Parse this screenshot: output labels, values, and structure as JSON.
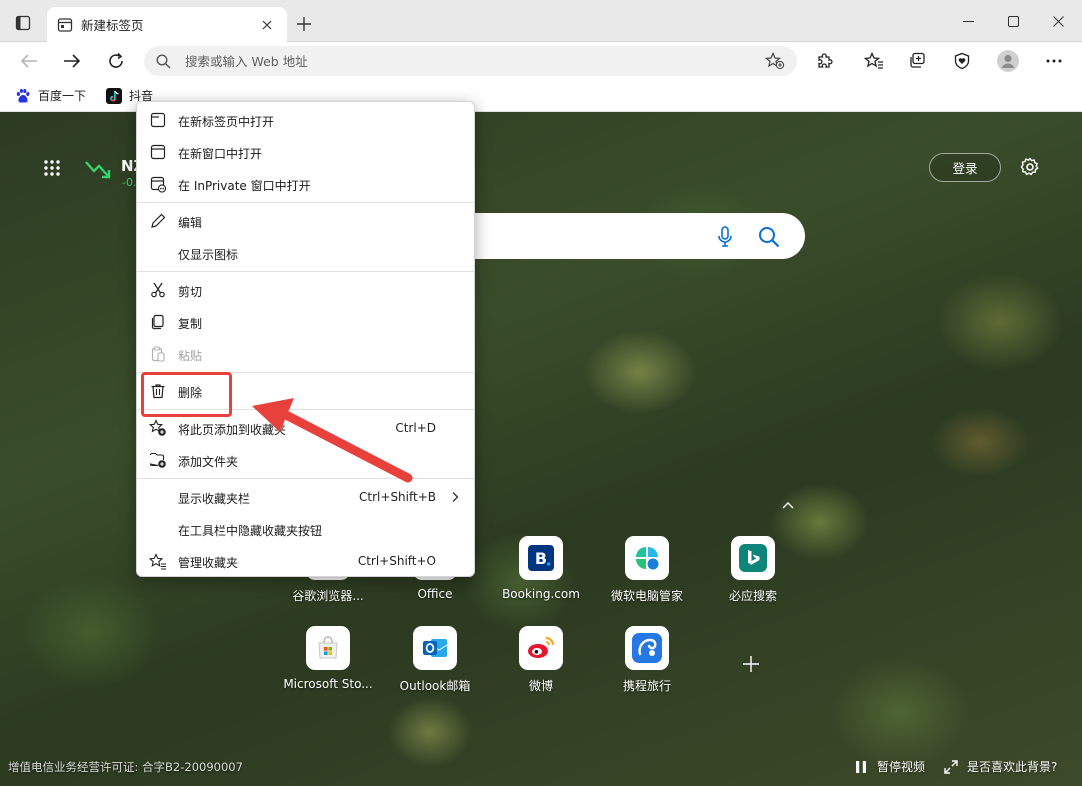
{
  "tab": {
    "title": "新建标签页"
  },
  "address": {
    "placeholder": "搜索或输入 Web 地址"
  },
  "bookmarks": [
    {
      "label": "百度一下",
      "icon": "baidu-icon"
    },
    {
      "label": "抖音",
      "icon": "tiktok-icon"
    }
  ],
  "newtab": {
    "stock_name": "NZ",
    "stock_change": "-0.",
    "login_label": "登录",
    "license": "增值电信业务经营许可证: 合字B2-20090007",
    "pause_video": "暂停视频",
    "like_background": "是否喜欢此背景?"
  },
  "tiles": [
    {
      "label": "谷歌浏览器...",
      "icon": "chrome-icon"
    },
    {
      "label": "Office",
      "icon": "office-icon"
    },
    {
      "label": "Booking.com",
      "icon": "booking-icon"
    },
    {
      "label": "微软电脑管家",
      "icon": "pc-manager-icon"
    },
    {
      "label": "必应搜索",
      "icon": "bing-icon"
    },
    {
      "label": "Microsoft Sto...",
      "icon": "store-icon"
    },
    {
      "label": "Outlook邮箱",
      "icon": "outlook-icon"
    },
    {
      "label": "微博",
      "icon": "weibo-icon"
    },
    {
      "label": "携程旅行",
      "icon": "ctrip-icon"
    }
  ],
  "context_menu": {
    "items": [
      {
        "label": "在新标签页中打开",
        "icon": "new-tab-icon"
      },
      {
        "label": "在新窗口中打开",
        "icon": "new-window-icon"
      },
      {
        "label": "在 InPrivate 窗口中打开",
        "icon": "inprivate-icon"
      },
      {
        "label": "编辑",
        "icon": "pencil-icon"
      },
      {
        "label": "仅显示图标"
      },
      {
        "label": "剪切",
        "icon": "scissors-icon"
      },
      {
        "label": "复制",
        "icon": "copy-icon"
      },
      {
        "label": "粘贴",
        "icon": "paste-icon",
        "disabled": true
      },
      {
        "label": "删除",
        "icon": "trash-icon"
      },
      {
        "label": "将此页添加到收藏夹",
        "icon": "add-favorite-icon",
        "shortcut": "Ctrl+D"
      },
      {
        "label": "添加文件夹",
        "icon": "add-folder-icon"
      },
      {
        "label": "显示收藏夹栏",
        "shortcut": "Ctrl+Shift+B",
        "submenu": true
      },
      {
        "label": "在工具栏中隐藏收藏夹按钮"
      },
      {
        "label": "管理收藏夹",
        "icon": "manage-favorites-icon",
        "shortcut": "Ctrl+Shift+O"
      }
    ]
  },
  "colors": {
    "accent": "#0078d4",
    "annotation": "#e8403b",
    "stock_down": "#36d26c"
  }
}
